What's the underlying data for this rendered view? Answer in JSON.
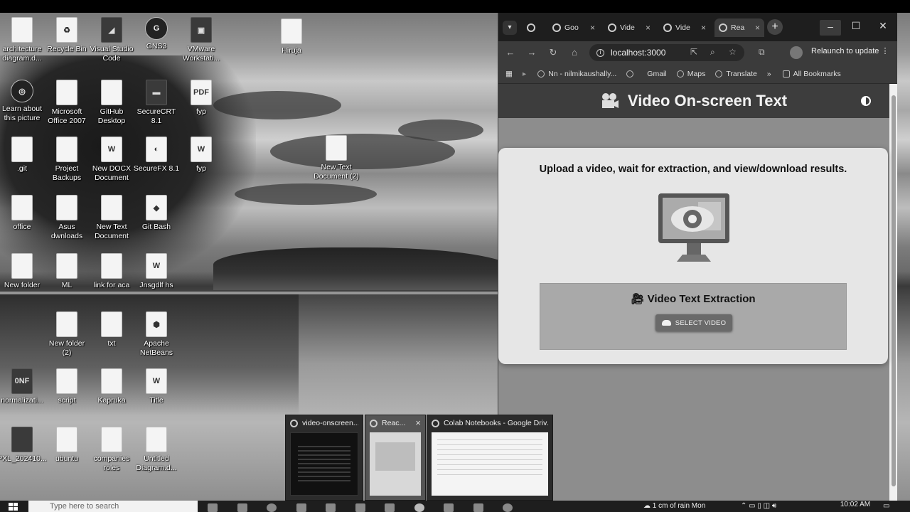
{
  "desktop": {
    "icons": [
      {
        "label": "architecture\ndiagram.d...",
        "glyph": ""
      },
      {
        "label": "Recycle Bin",
        "glyph": "♻"
      },
      {
        "label": "Visual Studio\nCode",
        "glyph": "◢"
      },
      {
        "label": "GNS3",
        "glyph": "G"
      },
      {
        "label": "VMware\nWorkstati...",
        "glyph": "▣"
      },
      {
        "label": "Hiruja",
        "glyph": ""
      },
      {
        "label": "Learn about\nthis picture",
        "glyph": "◎"
      },
      {
        "label": "Microsoft\nOffice 2007",
        "glyph": ""
      },
      {
        "label": "GitHub\nDesktop",
        "glyph": ""
      },
      {
        "label": "SecureCRT\n8.1",
        "glyph": "▬"
      },
      {
        "label": "fyp",
        "glyph": "PDF"
      },
      {
        "label": ".git",
        "glyph": ""
      },
      {
        "label": "Project\nBackups",
        "glyph": ""
      },
      {
        "label": "New DOCX\nDocument",
        "glyph": "W"
      },
      {
        "label": "SecureFX 8.1",
        "glyph": "◐"
      },
      {
        "label": "fyp",
        "glyph": "W"
      },
      {
        "label": "New Text\nDocument (2)",
        "glyph": ""
      },
      {
        "label": "office",
        "glyph": ""
      },
      {
        "label": "Asus\ndwnloads",
        "glyph": ""
      },
      {
        "label": "New Text\nDocument",
        "glyph": ""
      },
      {
        "label": "Git Bash",
        "glyph": "◆"
      },
      {
        "label": "New folder",
        "glyph": ""
      },
      {
        "label": "ML",
        "glyph": ""
      },
      {
        "label": "link for aca",
        "glyph": ""
      },
      {
        "label": "Jnsgdlf hs",
        "glyph": "W"
      },
      {
        "label": "New folder\n(2)",
        "glyph": ""
      },
      {
        "label": "txt",
        "glyph": ""
      },
      {
        "label": "Apache\nNetBeans",
        "glyph": "⬢"
      },
      {
        "label": "normalizati...",
        "glyph": "0NF"
      },
      {
        "label": "script",
        "glyph": ""
      },
      {
        "label": "Kapruka",
        "glyph": ""
      },
      {
        "label": "Title",
        "glyph": "W"
      },
      {
        "label": "PXL_202410...",
        "glyph": ""
      },
      {
        "label": "ubuntu",
        "glyph": ""
      },
      {
        "label": "companies\nroles",
        "glyph": ""
      },
      {
        "label": "Untitled\nDiagram.d...",
        "glyph": ""
      }
    ]
  },
  "browser": {
    "tabs": [
      {
        "label": "Goo",
        "close": "×"
      },
      {
        "label": "Vide",
        "close": "×"
      },
      {
        "label": "Vide",
        "close": "×"
      },
      {
        "label": "Rea",
        "close": "×"
      }
    ],
    "new_tab": "+",
    "window_controls": {
      "minimize": "–",
      "maximize": "☐",
      "close": "✕"
    },
    "address": "localhost:3000",
    "relaunch_label": "Relaunch to update",
    "bookmarks": [
      {
        "label": "Nn - nilmikaushally..."
      },
      {
        "label": "Gmail"
      },
      {
        "label": "Maps"
      },
      {
        "label": "Translate"
      }
    ],
    "bookmarks_overflow": "»",
    "all_bookmarks": "All Bookmarks"
  },
  "app": {
    "title": "Video On-screen Text",
    "subtitle": "Upload a video, wait for extraction, and view/download results.",
    "section_heading": "Video Text Extraction",
    "select_button": "SELECT VIDEO"
  },
  "previews": [
    {
      "title": "video-onscreen...",
      "close": ""
    },
    {
      "title": "Reac...",
      "close": "×"
    },
    {
      "title": "Colab Notebooks - Google Driv...",
      "close": ""
    }
  ],
  "taskbar": {
    "search_placeholder": "Type here to search",
    "weather": "1 cm of rain Mon",
    "time": "10:02 AM"
  }
}
